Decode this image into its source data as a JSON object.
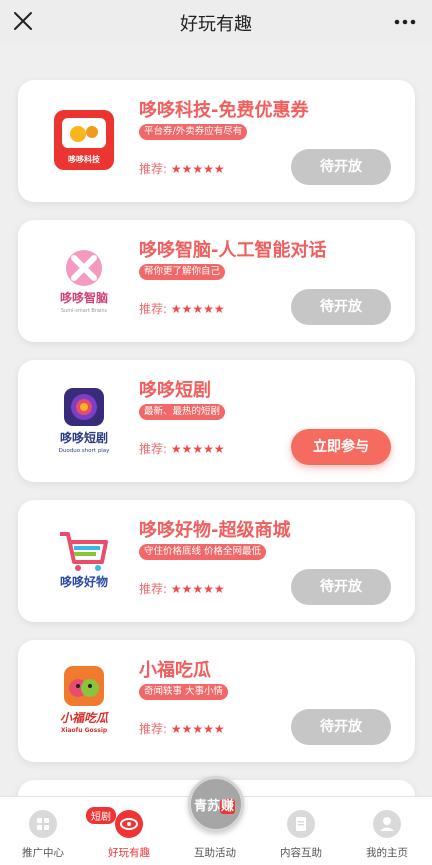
{
  "header": {
    "title": "好玩有趣",
    "close_icon": "close-icon",
    "more_icon": "more-icon"
  },
  "cards": [
    {
      "name": "哆哆科技-免费优惠券",
      "tag": "平台券/外卖券应有尽有",
      "rec_label": "推荐:",
      "stars": "★★★★★",
      "button": "待开放",
      "logo_text": "哆哆科技",
      "logo_color": "#e8322f"
    },
    {
      "name": "哆哆智脑-人工智能对话",
      "tag": "帮你更了解你自己",
      "rec_label": "推荐:",
      "stars": "★★★★★",
      "button": "待开放",
      "logo_text": "哆哆智脑",
      "logo_sub": "Sumi-smart Brains",
      "logo_color": "#d9407a"
    },
    {
      "name": "哆哆短剧",
      "tag": "最新、最热的短剧",
      "rec_label": "推荐:",
      "stars": "★★★★★",
      "button": "立即参与",
      "logo_text": "哆哆短剧",
      "logo_sub": "Duoduo short play",
      "logo_color": "#2b3c86"
    },
    {
      "name": "哆哆好物-超级商城",
      "tag": "守住价格底线 价格全网最低",
      "rec_label": "推荐:",
      "stars": "★★★★★",
      "button": "待开放",
      "logo_text": "哆哆好物",
      "logo_color": "#2a4aa8"
    },
    {
      "name": "小福吃瓜",
      "tag": "奇闻轶事 大事小情",
      "rec_label": "推荐:",
      "stars": "★★★★★",
      "button": "待开放",
      "logo_text": "小福吃瓜",
      "logo_sub": "Xiaofu Gossip",
      "logo_color": "#d8312c"
    }
  ],
  "tabbar": {
    "tabs": [
      {
        "label": "推广中心"
      },
      {
        "label": "好玩有趣",
        "badge": "短剧"
      },
      {
        "label": "互助活动"
      },
      {
        "label": "内容互助"
      },
      {
        "label": "我的主页"
      }
    ],
    "center_text_a": "青苏",
    "center_text_b": "赚"
  }
}
